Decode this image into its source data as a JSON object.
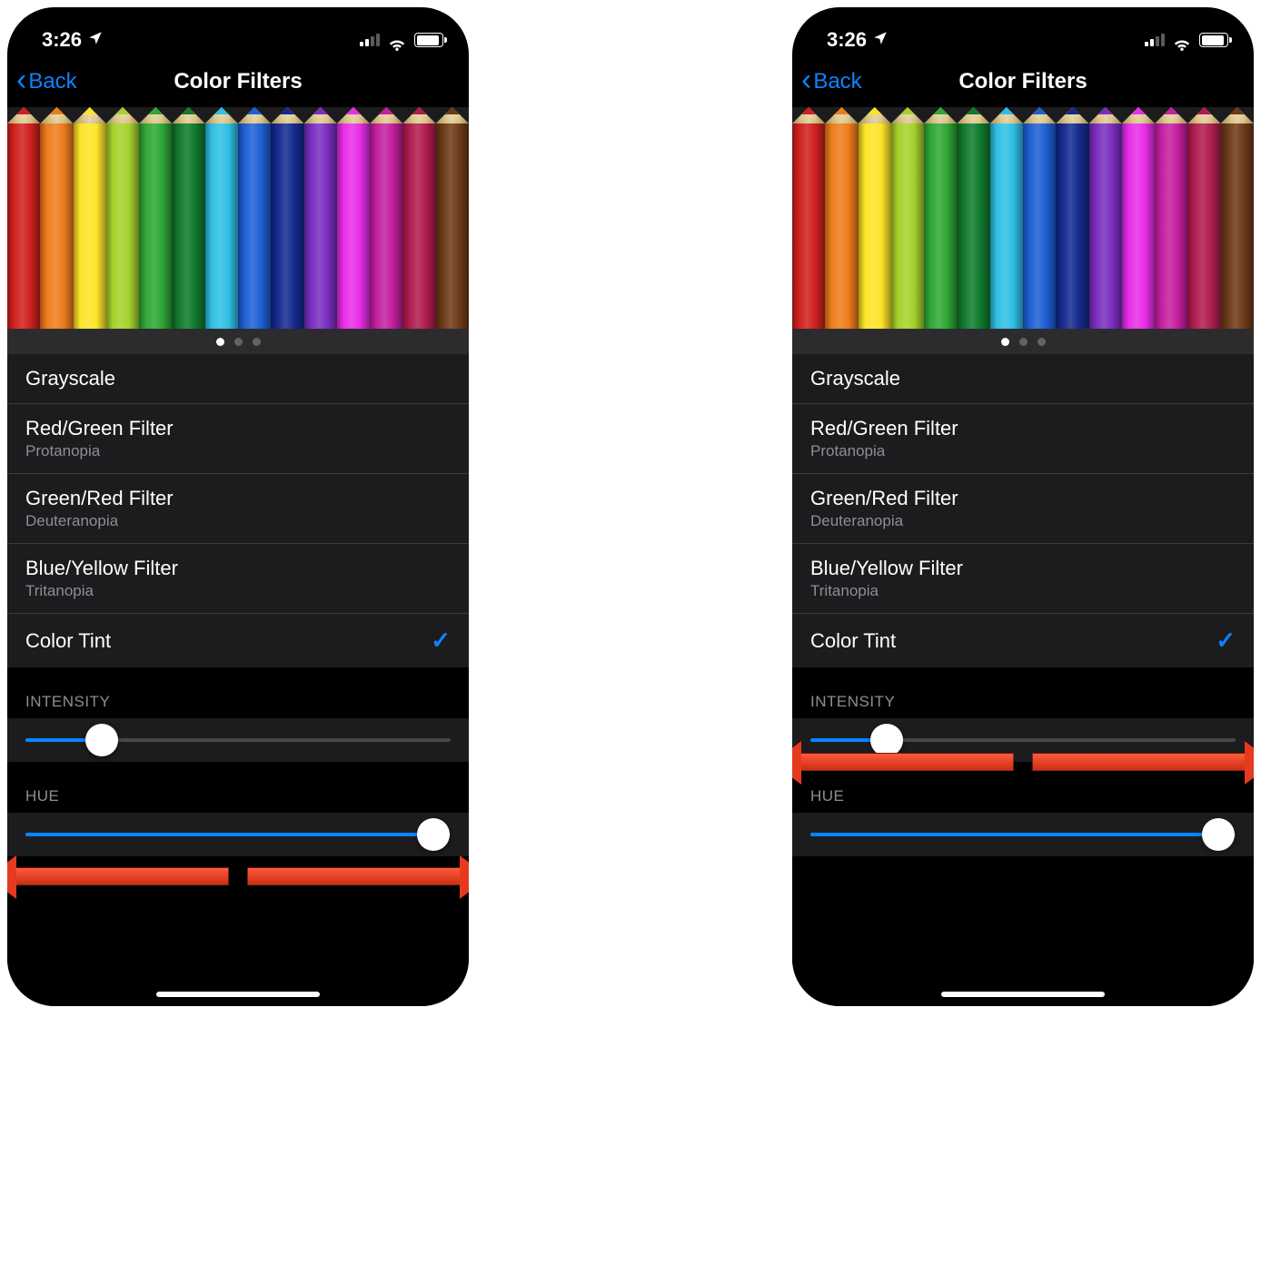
{
  "status": {
    "time": "3:26",
    "signal_bars_active": 2,
    "signal_bars_total": 4
  },
  "nav": {
    "back_label": "Back",
    "title": "Color Filters"
  },
  "preview": {
    "pencil_colors": [
      "#d0201f",
      "#ef7c1b",
      "#fde428",
      "#a4d22b",
      "#2fa836",
      "#0f7a2e",
      "#2fc0e5",
      "#1f5fd6",
      "#152a8f",
      "#7a2ec0",
      "#e82ee8",
      "#c51fa0",
      "#b01c4f",
      "#6d3a17"
    ],
    "pager_active_index": 0,
    "pager_count": 3
  },
  "filters": [
    {
      "title": "Grayscale",
      "sub": null,
      "selected": false
    },
    {
      "title": "Red/Green Filter",
      "sub": "Protanopia",
      "selected": false
    },
    {
      "title": "Green/Red Filter",
      "sub": "Deuteranopia",
      "selected": false
    },
    {
      "title": "Blue/Yellow Filter",
      "sub": "Tritanopia",
      "selected": false
    },
    {
      "title": "Color Tint",
      "sub": null,
      "selected": true
    }
  ],
  "sliders": {
    "intensity": {
      "label": "INTENSITY",
      "value_pct": 18
    },
    "hue": {
      "label": "HUE",
      "value_pct": 96
    }
  },
  "screens": [
    {
      "arrow_on": "hue"
    },
    {
      "arrow_on": "intensity"
    }
  ]
}
